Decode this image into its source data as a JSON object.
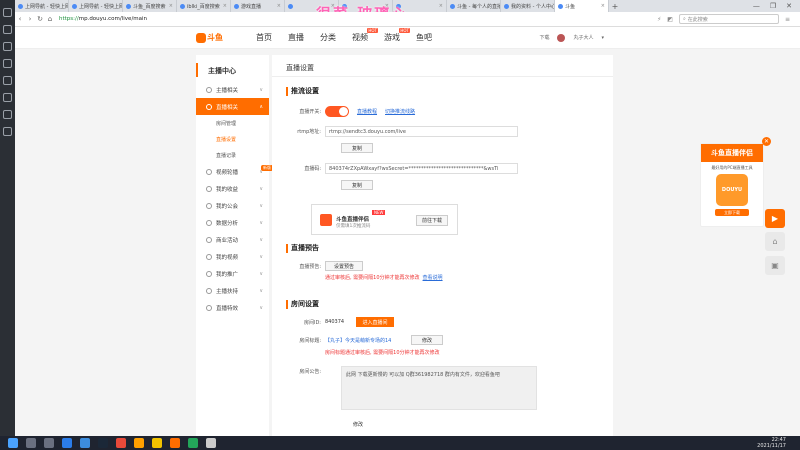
{
  "browser": {
    "tabs": [
      {
        "label": "上网导航 - 轻快上网",
        "active": false
      },
      {
        "label": "上网导航 - 轻快上网",
        "active": false
      },
      {
        "label": "斗鱼_百度搜索",
        "active": false
      },
      {
        "label": "iblki_百度搜索",
        "active": false
      },
      {
        "label": "游戏直播",
        "active": false
      },
      {
        "label": "",
        "active": false
      },
      {
        "label": "",
        "active": false
      },
      {
        "label": "",
        "active": false
      },
      {
        "label": "斗鱼 - 每个人的直播",
        "active": false
      },
      {
        "label": "我的资料 - 个人中心",
        "active": false
      },
      {
        "label": "斗鱼",
        "active": true
      }
    ],
    "overlay_text": "很菜 玻璃心",
    "url_proto": "https://",
    "url_rest": "mp.douyu.com/live/main",
    "search_placeholder": "在此搜索",
    "new_tab": "+",
    "win_min": "—",
    "win_max": "❐",
    "win_close": "✕"
  },
  "site": {
    "logo_text": "斗鱼",
    "nav": [
      "首页",
      "直播",
      "分类",
      "视频",
      "游戏",
      "鱼吧"
    ],
    "nav_hot": "HOT",
    "download": "下载",
    "username": "丸子大人"
  },
  "sidebar": {
    "title": "主播中心",
    "items": [
      {
        "label": "主播相关",
        "active": false
      },
      {
        "label": "直播相关",
        "active": true
      }
    ],
    "subs": [
      {
        "label": "房间管理",
        "active": false
      },
      {
        "label": "直播设置",
        "active": true
      },
      {
        "label": "直播记录",
        "active": false
      }
    ],
    "items2": [
      "视频轮播",
      "我的收益",
      "我的公会",
      "数据分析",
      "商业活动",
      "我的视频",
      "我的推广",
      "主播扶持",
      "直播特效"
    ],
    "badge": "新版"
  },
  "content": {
    "header": "直播设置",
    "stream": {
      "title": "推流设置",
      "switch_label": "直播开关:",
      "link1": "直播教程",
      "link2": "切换推流线路",
      "rtmp_label": "rtmp地址:",
      "rtmp_value": "rtmp://sendtc3.douyu.com/live",
      "copy": "复制",
      "code_label": "直播码:",
      "code_value": "840374rZXpAWxayf?wsSecret=******************************&wsTi",
      "copy2": "复制"
    },
    "promo": {
      "title": "斗鱼直播伴侣",
      "sub": "仅需填1次推流码",
      "new": "NEW",
      "download": "前往下载"
    },
    "preview": {
      "title": "直播预告",
      "label": "直播预告:",
      "btn": "设置预告",
      "warn": "通过审核后, 需要间隔10分钟才能再次修改",
      "link": "查看说明"
    },
    "room": {
      "title": "房间设置",
      "id_label": "房间ID:",
      "id_value": "840374",
      "id_btn": "进入直播间",
      "title_label": "房间标题:",
      "title_value": "【丸子】今天是萌新专场的14",
      "title_btn": "修改",
      "title_warn": "房间标题通过审核后, 需要间隔10分钟才能再次修改",
      "notice_label": "房间公告:",
      "notice_text": "此网 下载更新慢的 可以加 Q群361982718 群内有文件，欢迎看鱼吧",
      "notice_btn": "修改"
    }
  },
  "float_ad": {
    "title": "斗鱼直播伴侣",
    "desc": "最好用的PC端直播工具",
    "img_text": "DOUYU",
    "get": "立即下载",
    "close": "✕"
  },
  "system": {
    "time": "22:47",
    "date": "2021/11/17"
  },
  "colors": {
    "accent": "#ff6d00",
    "toggle": "#ff5722",
    "overlay": "#ff63b6",
    "link": "#2a6cd8",
    "warn": "#ee3333"
  }
}
